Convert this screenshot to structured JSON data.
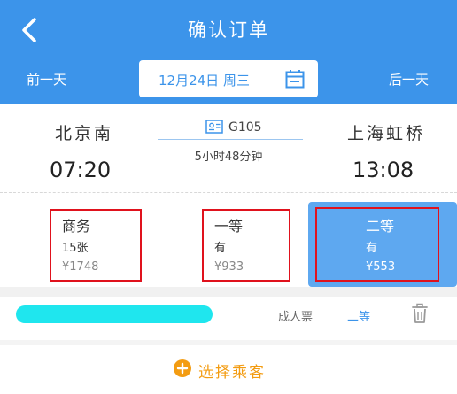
{
  "header": {
    "title": "确认订单",
    "prev_day": "前一天",
    "next_day": "后一天",
    "date": "12月24日 周三"
  },
  "train": {
    "from_station": "北京南",
    "to_station": "上海虹桥",
    "depart_time": "07:20",
    "arrive_time": "13:08",
    "train_no": "G105",
    "duration": "5小时48分钟"
  },
  "seats": [
    {
      "name": "商务",
      "availability": "15张",
      "price": "¥1748",
      "selected": false
    },
    {
      "name": "一等",
      "availability": "有",
      "price": "¥933",
      "selected": false
    },
    {
      "name": "二等",
      "availability": "有",
      "price": "¥553",
      "selected": true
    }
  ],
  "passenger": {
    "ticket_type": "成人票",
    "seat_class": "二等"
  },
  "actions": {
    "add_passenger": "选择乘客"
  },
  "colors": {
    "primary": "#3c94ea",
    "selected_seat": "#5ea8f0",
    "highlight_box": "#e0121d",
    "redaction": "#1fe6ee",
    "add_accent": "#f39c12"
  },
  "icons": {
    "back": "chevron-left-icon",
    "calendar": "calendar-icon",
    "train_card": "id-card-icon",
    "trash": "trash-icon",
    "add": "plus-circle-icon"
  }
}
